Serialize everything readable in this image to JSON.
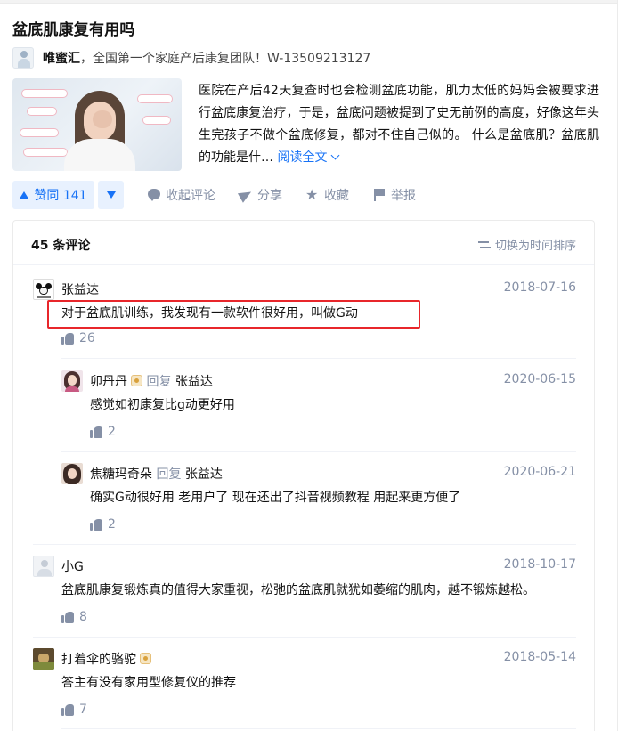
{
  "question": {
    "title": "盆底肌康复有用吗"
  },
  "answer": {
    "author_name": "唯蜜汇",
    "author_desc": "，全国第一个家庭产后康复团队！W-13509213127",
    "excerpt": "医院在产后42天复查时也会检测盆底功能，肌力太低的妈妈会被要求进行盆底康复治疗，于是，盆底问题被提到了史无前例的高度，好像这年头生完孩子不做个盆底修复，都对不住自己似的。 什么是盆底肌？盆底肌的功能是什…",
    "read_more": "阅读全文"
  },
  "actions": {
    "vote_label": "赞同 141",
    "collapse_comments": "收起评论",
    "share": "分享",
    "favorite": "收藏",
    "report": "举报"
  },
  "comments_panel": {
    "count_label": "45 条评论",
    "sort_label": "切换为时间排序",
    "reply_word": "回复",
    "items": [
      {
        "name": "张益达",
        "date": "2018-07-16",
        "text": "对于盆底肌训练，我发现有一款软件很好用，叫做G动",
        "likes": "26"
      },
      {
        "name": "卯丹丹",
        "reply_to": "张益达",
        "date": "2020-06-15",
        "text": "感觉如初康复比g动更好用",
        "likes": "2"
      },
      {
        "name": "焦糖玛奇朵",
        "reply_to": "张益达",
        "date": "2020-06-21",
        "text": "确实G动很好用 老用户了 现在还出了抖音视频教程 用起来更方便了",
        "likes": "2"
      },
      {
        "name": "小G",
        "date": "2018-10-17",
        "text": "盆底肌康复锻炼真的值得大家重视，松弛的盆底肌就犹如萎缩的肌肉，越不锻炼越松。",
        "likes": "8"
      },
      {
        "name": "打着伞的骆驼",
        "date": "2018-05-14",
        "text": "答主有没有家用型修复仪的推荐",
        "likes": "7"
      }
    ]
  },
  "colors": {
    "accent": "#1772f6",
    "muted": "#8590a6",
    "highlight_border": "#e8262b"
  },
  "icons": {
    "comment": "comment-icon",
    "share": "share-icon",
    "favorite": "star-icon",
    "report": "flag-icon",
    "like": "thumb-up-icon",
    "sort": "swap-icon",
    "badge": "member-badge-icon"
  }
}
